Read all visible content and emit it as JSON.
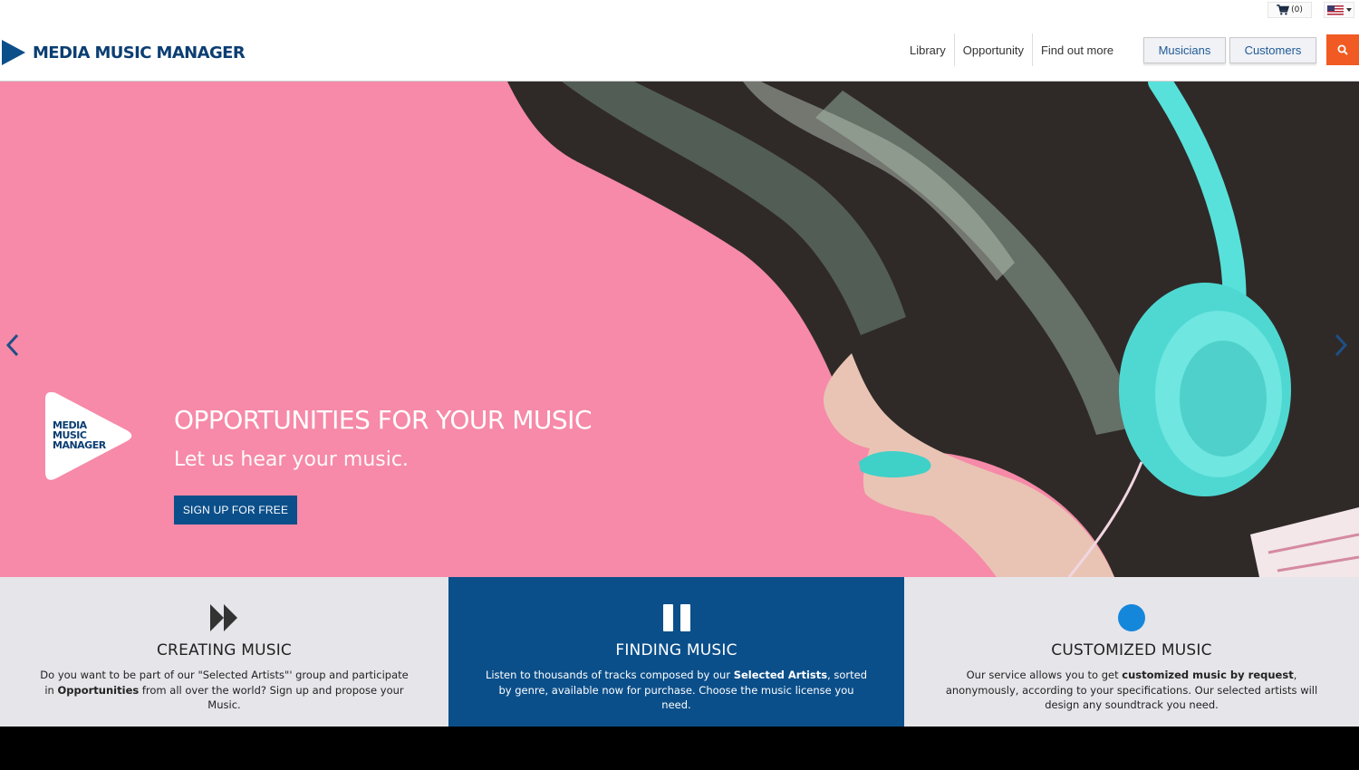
{
  "topbar": {
    "cart_count": "(0)",
    "cart_icon": "shopping-cart-icon",
    "language_icon": "us-flag-icon"
  },
  "brand": {
    "name": "MEDIA MUSIC MANAGER",
    "color": "#0b4f8a",
    "accent": "#f15a22"
  },
  "nav": {
    "items": [
      "Library",
      "Opportunity",
      "Find out more"
    ],
    "musicians_label": "Musicians",
    "customers_label": "Customers",
    "search_icon": "search-icon"
  },
  "hero": {
    "badge_line1": "MEDIA",
    "badge_line2": "MUSIC",
    "badge_line3": "MANAGER",
    "title": "OPPORTUNITIES FOR YOUR MUSIC",
    "subtitle": "Let us hear your music.",
    "cta_label": "SIGN UP FOR FREE",
    "background_color": "#f68aa8"
  },
  "features": [
    {
      "icon": "fast-forward-icon",
      "title": "CREATING MUSIC",
      "text_a": "Do you want to be part of our \"Selected Artists\"' group and participate in ",
      "text_bold": "Opportunities",
      "text_b": " from all over the world? Sign up and propose your Music."
    },
    {
      "icon": "pause-icon",
      "title": "FINDING MUSIC",
      "text_a": "Listen to thousands of tracks composed by our ",
      "text_bold": "Selected Artists",
      "text_b": ", sorted by genre, available now for purchase. Choose the music license you need."
    },
    {
      "icon": "record-dot-icon",
      "title": "CUSTOMIZED MUSIC",
      "text_a": "Our service allows you to get ",
      "text_bold": "customized music by request",
      "text_b": ", anonymously, according to your specifications. Our selected artists will design any soundtrack you need."
    }
  ]
}
